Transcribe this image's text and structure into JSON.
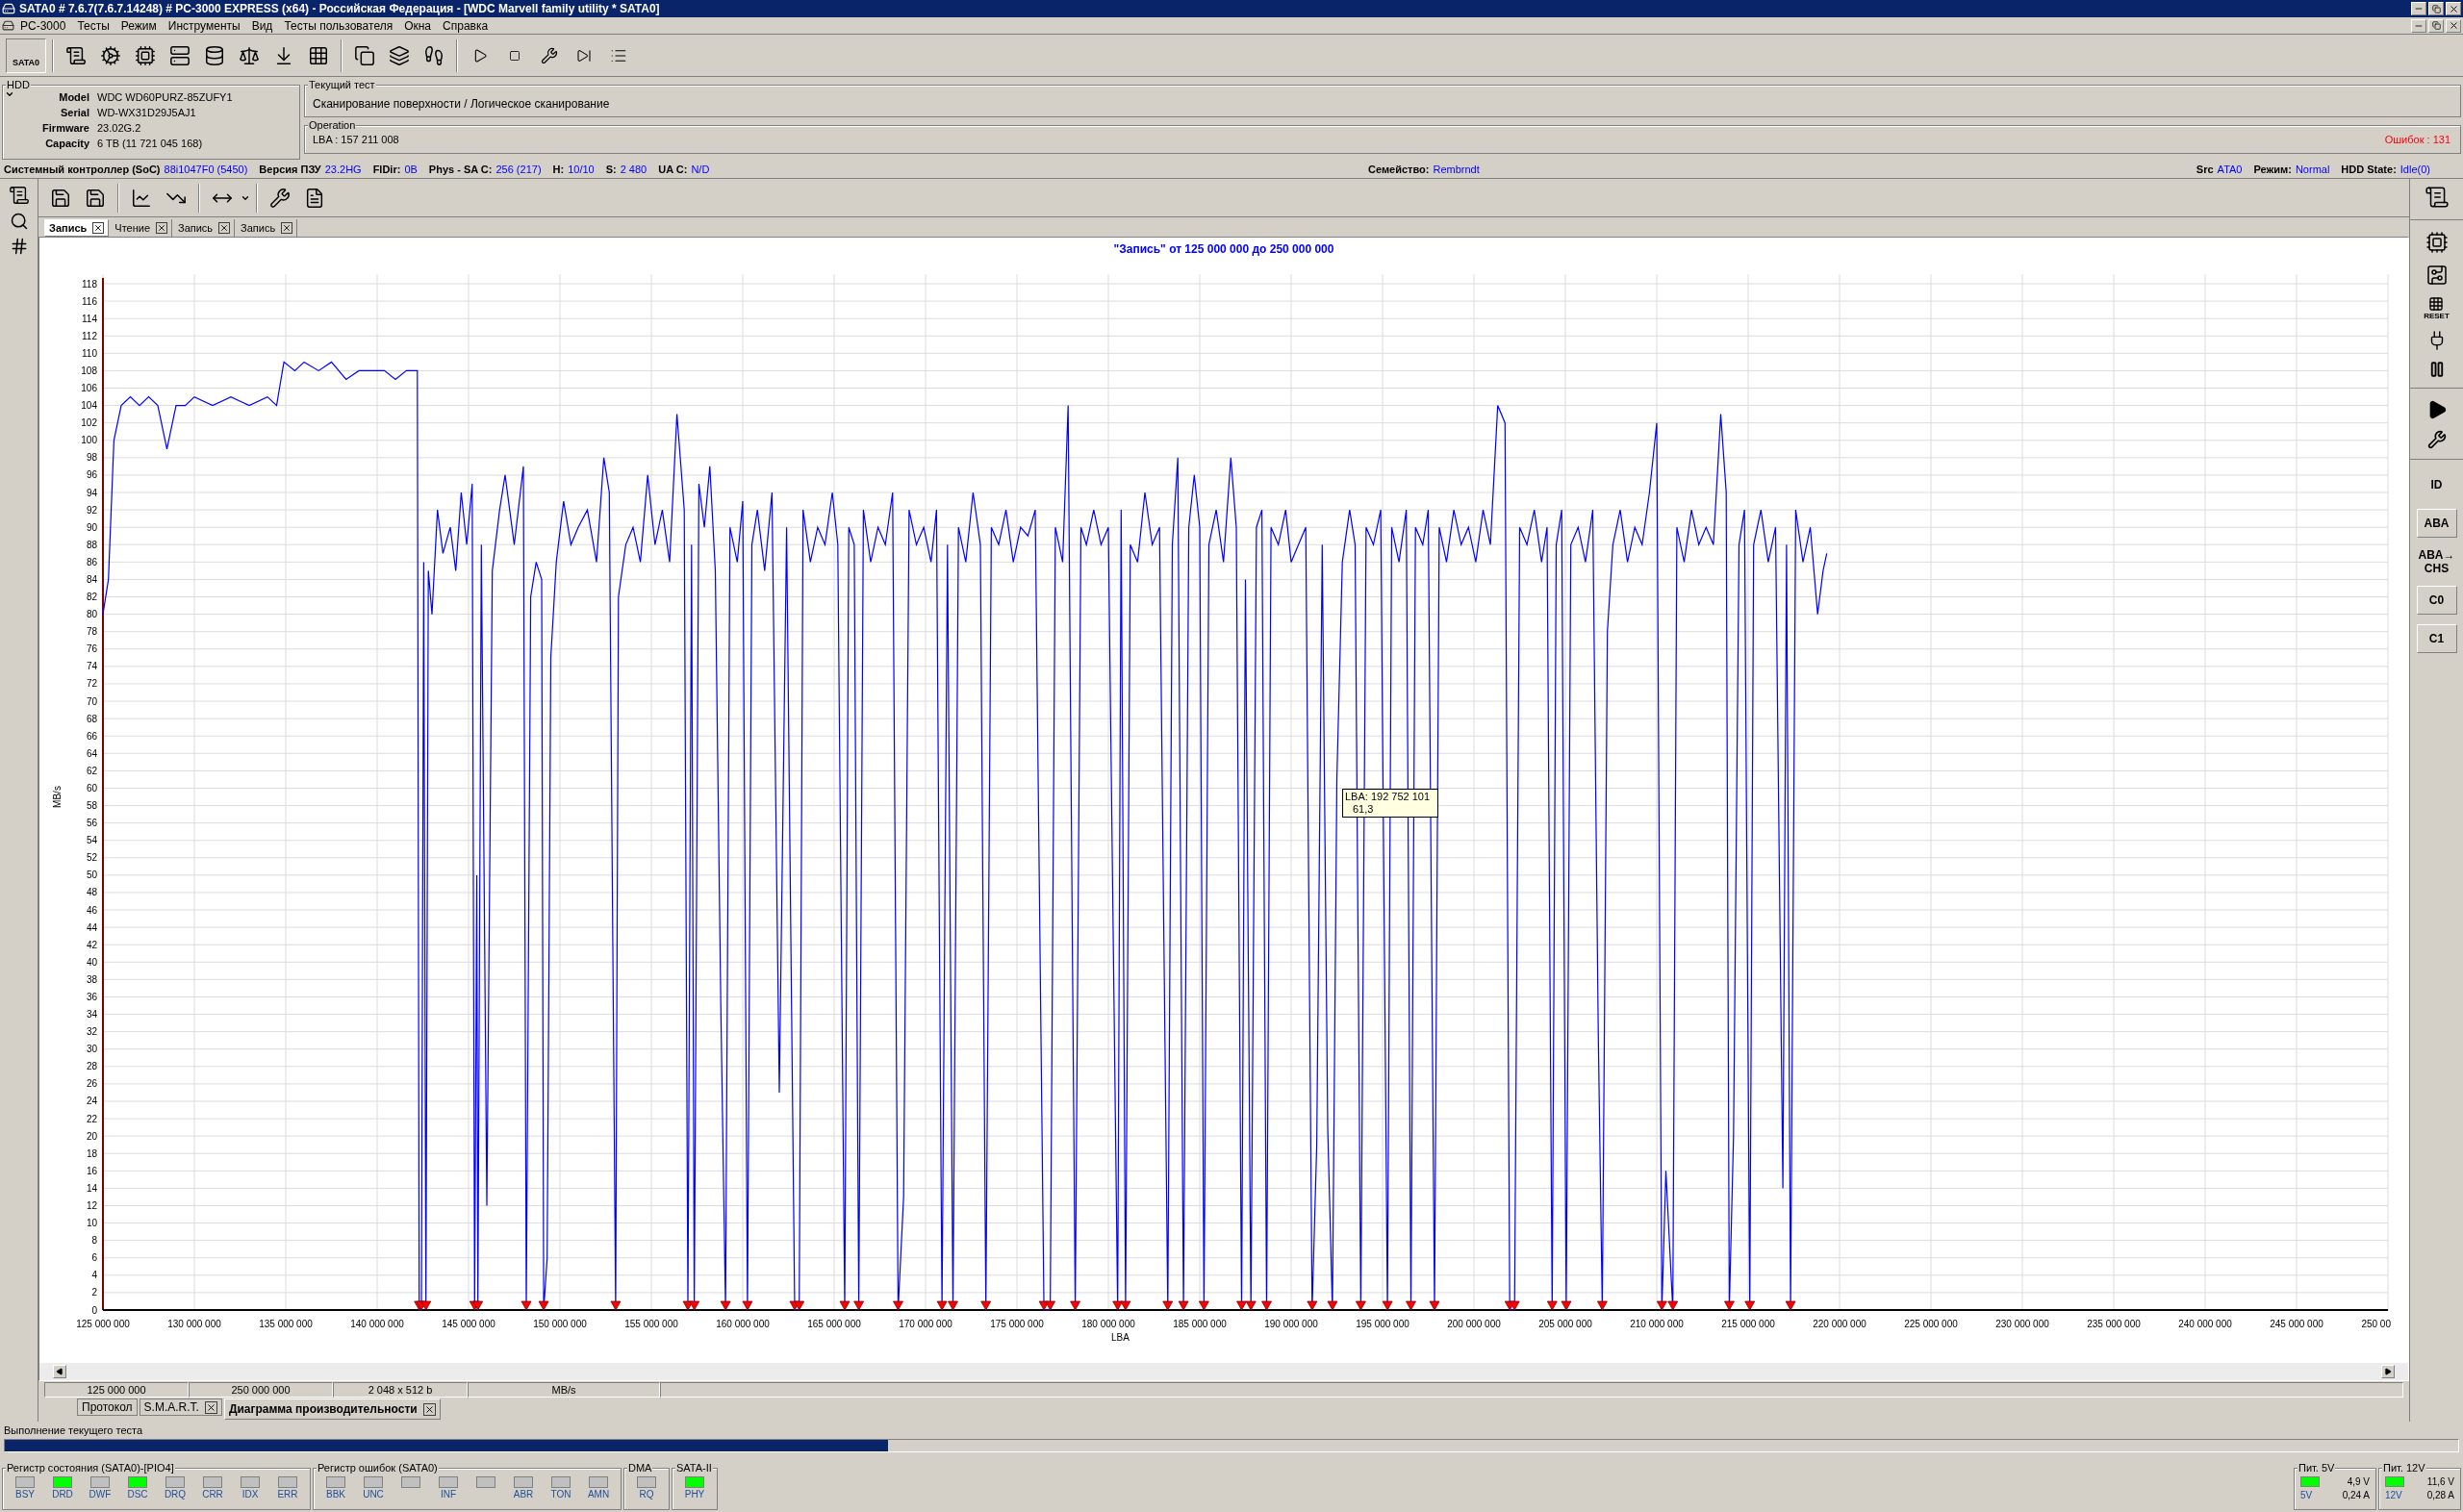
{
  "window": {
    "title": "SATA0 # 7.6.7(7.6.7.14248) # PC-3000 EXPRESS (x64) - Российская Федерация - [WDC Marvell family utility * SATA0]"
  },
  "menu": [
    "PC-3000",
    "Тесты",
    "Режим",
    "Инструменты",
    "Вид",
    "Тесты пользователя",
    "Окна",
    "Справка"
  ],
  "toolbar": {
    "port": "SATA0"
  },
  "hdd": {
    "title": "HDD",
    "fields": [
      {
        "label": "Model",
        "value": "WDC WD60PURZ-85ZUFY1"
      },
      {
        "label": "Serial",
        "value": "WD-WX31D29J5AJ1"
      },
      {
        "label": "Firmware",
        "value": "23.02G.2"
      },
      {
        "label": "Capacity",
        "value": "6 TB (11 721 045 168)"
      }
    ]
  },
  "current_test": {
    "title": "Текущий тест",
    "text": "Сканирование поверхности / Логическое сканирование"
  },
  "operation": {
    "title": "Operation",
    "text": "LBA : 157 211 008",
    "errors": "Ошибок : 131"
  },
  "info_line": {
    "left": [
      {
        "label": "Системный контроллер (SoC)",
        "value": "88i1047F0 (5450)"
      },
      {
        "label": "Версия ПЗУ",
        "value": "23.2HG"
      },
      {
        "label": "FlDir:",
        "value": "0B"
      },
      {
        "label": "Phys - SA C:",
        "value": "256 (217)"
      },
      {
        "label": "H:",
        "value": "10/10"
      },
      {
        "label": "S:",
        "value": "2 480"
      },
      {
        "label": "UA C:",
        "value": "N/D"
      }
    ],
    "middle": [
      {
        "label": "Семейство:",
        "value": "Rembrndt"
      }
    ],
    "right": [
      {
        "label": "Src",
        "value": "ATA0"
      },
      {
        "label": "Режим:",
        "value": "Normal"
      },
      {
        "label": "HDD State:",
        "value": "Idle(0)"
      }
    ]
  },
  "right_toolbar": {
    "reset_label": "RESET",
    "buttons": [
      "ID",
      "ABA",
      "ABA→CHS",
      "C0",
      "C1"
    ]
  },
  "chart_tabs": [
    {
      "label": "Запись",
      "selected": true
    },
    {
      "label": "Чтение",
      "selected": false
    },
    {
      "label": "Запись",
      "selected": false
    },
    {
      "label": "Запись",
      "selected": false
    }
  ],
  "chart": {
    "tooltip": {
      "lba": "LBA: 192 752 101",
      "value": "61,3"
    },
    "chart_data": {
      "type": "line",
      "title": "\"Запись\" от 125 000 000 до 250 000 000",
      "xlabel": "LBA",
      "ylabel": "MB/s",
      "xlim": [
        125000000,
        250000000
      ],
      "ylim": [
        0,
        118
      ],
      "yticks": [
        0,
        2,
        4,
        6,
        8,
        10,
        12,
        14,
        16,
        18,
        20,
        22,
        24,
        26,
        28,
        30,
        32,
        34,
        36,
        38,
        40,
        42,
        44,
        46,
        48,
        50,
        52,
        54,
        56,
        58,
        60,
        62,
        64,
        66,
        68,
        70,
        72,
        74,
        76,
        78,
        80,
        82,
        84,
        86,
        88,
        90,
        92,
        94,
        96,
        98,
        100,
        102,
        104,
        106,
        108,
        110,
        112,
        114,
        116,
        118
      ],
      "xticks": [
        {
          "value": 125000000,
          "label": "125 000 000"
        },
        {
          "value": 130000000,
          "label": "130 000 000"
        },
        {
          "value": 135000000,
          "label": "135 000 000"
        },
        {
          "value": 140000000,
          "label": "140 000 000"
        },
        {
          "value": 145000000,
          "label": "145 000 000"
        },
        {
          "value": 150000000,
          "label": "150 000 000"
        },
        {
          "value": 155000000,
          "label": "155 000 000"
        },
        {
          "value": 160000000,
          "label": "160 000 000"
        },
        {
          "value": 165000000,
          "label": "165 000 000"
        },
        {
          "value": 170000000,
          "label": "170 000 000"
        },
        {
          "value": 175000000,
          "label": "175 000 000"
        },
        {
          "value": 180000000,
          "label": "180 000 000"
        },
        {
          "value": 185000000,
          "label": "185 000 000"
        },
        {
          "value": 190000000,
          "label": "190 000 000"
        },
        {
          "value": 195000000,
          "label": "195 000 000"
        },
        {
          "value": 200000000,
          "label": "200 000 000"
        },
        {
          "value": 205000000,
          "label": "205 000 000"
        },
        {
          "value": 210000000,
          "label": "210 000 000"
        },
        {
          "value": 215000000,
          "label": "215 000 000"
        },
        {
          "value": 220000000,
          "label": "220 000 000"
        },
        {
          "value": 225000000,
          "label": "225 000 000"
        },
        {
          "value": 230000000,
          "label": "230 000 000"
        },
        {
          "value": 235000000,
          "label": "235 000 000"
        },
        {
          "value": 240000000,
          "label": "240 000 000"
        },
        {
          "value": 245000000,
          "label": "245 000 000"
        },
        {
          "value": 250000000,
          "label": "250 00"
        }
      ],
      "x": [
        125000000,
        125300000,
        125600000,
        126000000,
        126500000,
        127000000,
        127500000,
        128000000,
        128500000,
        129000000,
        129500000,
        130000000,
        131000000,
        132000000,
        133000000,
        134000000,
        134500000,
        134900000,
        135500000,
        136000000,
        136800000,
        137500000,
        138300000,
        139000000,
        139700000,
        140400000,
        141000000,
        141600000,
        142200000,
        142300000,
        142420000,
        142550000,
        142670000,
        142800000,
        143000000,
        143300000,
        143600000,
        144000000,
        144300000,
        144600000,
        144900000,
        145200000,
        145330000,
        145450000,
        145510000,
        145700000,
        146000000,
        146300000,
        146700000,
        147000000,
        147500000,
        148000000,
        148160000,
        148400000,
        148700000,
        149000000,
        149110000,
        149300000,
        149500000,
        149800000,
        150200000,
        150600000,
        151000000,
        151500000,
        152000000,
        152400000,
        152700000,
        153050000,
        153200000,
        153600000,
        154000000,
        154400000,
        154800000,
        155200000,
        155600000,
        156000000,
        156400000,
        156800000,
        157000000,
        157200000,
        157350000,
        157600000,
        157900000,
        158200000,
        158500000,
        158800000,
        159060000,
        159300000,
        159700000,
        160000000,
        160260000,
        160500000,
        160800000,
        161200000,
        161600000,
        162000000,
        162400000,
        162840000,
        163090000,
        163300000,
        163700000,
        164100000,
        164500000,
        164900000,
        165200000,
        165580000,
        165800000,
        166100000,
        166350000,
        166600000,
        167000000,
        167400000,
        167800000,
        168200000,
        168500000,
        168800000,
        169100000,
        169500000,
        169900000,
        170300000,
        170600000,
        170900000,
        171200000,
        171500000,
        171800000,
        172200000,
        172600000,
        173000000,
        173300000,
        173600000,
        174000000,
        174400000,
        174800000,
        175200000,
        175600000,
        176000000,
        176480000,
        176820000,
        177100000,
        177500000,
        177800000,
        178190000,
        178500000,
        178800000,
        179200000,
        179600000,
        180000000,
        180510000,
        180700000,
        180940000,
        181200000,
        181600000,
        182000000,
        182400000,
        182800000,
        183250000,
        183500000,
        183800000,
        184110000,
        184400000,
        184700000,
        185000000,
        185230000,
        185500000,
        185900000,
        186300000,
        186700000,
        187000000,
        187290000,
        187500000,
        187800000,
        188100000,
        188400000,
        188660000,
        188900000,
        189300000,
        189700000,
        190000000,
        190400000,
        190800000,
        191150000,
        191400000,
        191700000,
        192000000,
        192260000,
        192500000,
        192800000,
        193200000,
        193500000,
        193810000,
        194100000,
        194500000,
        194900000,
        195270000,
        195500000,
        195900000,
        196300000,
        196550000,
        196800000,
        197200000,
        197500000,
        197840000,
        198100000,
        198500000,
        198900000,
        199300000,
        199700000,
        200100000,
        200500000,
        200900000,
        201300000,
        201700000,
        201960000,
        202220000,
        202500000,
        202900000,
        203300000,
        203700000,
        204000000,
        204280000,
        204500000,
        204800000,
        205050000,
        205300000,
        205700000,
        206100000,
        206500000,
        206800000,
        207020000,
        207300000,
        207600000,
        208000000,
        208400000,
        208800000,
        209200000,
        209600000,
        210000000,
        210280000,
        210500000,
        210880000,
        211100000,
        211500000,
        211900000,
        212300000,
        212700000,
        213100000,
        213500000,
        213800000,
        213970000,
        214200000,
        214500000,
        214800000,
        215090000,
        215300000,
        215700000,
        216100000,
        216500000,
        216900000,
        217100000,
        217320000,
        217600000,
        218000000,
        218400000,
        218800000,
        219100000,
        219300000
      ],
      "values": [
        80,
        84,
        100,
        104,
        105,
        104,
        105,
        104,
        99,
        104,
        104,
        105,
        104,
        105,
        104,
        105,
        104,
        109,
        108,
        109,
        108,
        109,
        107,
        108,
        108,
        108,
        107,
        108,
        108,
        0,
        0,
        86,
        0,
        85,
        80,
        92,
        87,
        90,
        85,
        94,
        88,
        95,
        0,
        50,
        0,
        88,
        12,
        85,
        92,
        96,
        88,
        97,
        0,
        82,
        86,
        84,
        0,
        6,
        75,
        86,
        93,
        88,
        90,
        92,
        86,
        98,
        94,
        0,
        82,
        88,
        90,
        86,
        96,
        88,
        92,
        86,
        103,
        92,
        0,
        88,
        0,
        95,
        90,
        97,
        85,
        35,
        0,
        90,
        86,
        93,
        0,
        88,
        92,
        85,
        94,
        25,
        90,
        0,
        0,
        92,
        86,
        90,
        88,
        94,
        88,
        0,
        90,
        88,
        0,
        92,
        86,
        90,
        88,
        94,
        0,
        13,
        92,
        88,
        90,
        86,
        92,
        0,
        88,
        0,
        90,
        86,
        94,
        88,
        0,
        90,
        88,
        92,
        86,
        90,
        89,
        92,
        0,
        0,
        90,
        86,
        104,
        0,
        90,
        88,
        92,
        88,
        90,
        0,
        92,
        0,
        88,
        86,
        94,
        88,
        90,
        0,
        88,
        98,
        0,
        90,
        96,
        90,
        0,
        88,
        92,
        86,
        98,
        90,
        0,
        84,
        0,
        90,
        92,
        0,
        90,
        88,
        92,
        86,
        88,
        90,
        0,
        19,
        88,
        21,
        0,
        61,
        86,
        92,
        88,
        0,
        90,
        88,
        92,
        0,
        90,
        86,
        92,
        0,
        90,
        88,
        92,
        0,
        90,
        86,
        92,
        88,
        90,
        86,
        92,
        88,
        104,
        102,
        0,
        0,
        90,
        88,
        92,
        86,
        90,
        0,
        88,
        92,
        0,
        88,
        90,
        86,
        92,
        32,
        0,
        78,
        88,
        92,
        86,
        90,
        88,
        94,
        102,
        0,
        16,
        0,
        90,
        86,
        92,
        88,
        90,
        88,
        103,
        94,
        0,
        20,
        88,
        92,
        0,
        88,
        92,
        86,
        90,
        14,
        88,
        0,
        92,
        86,
        90,
        80,
        85,
        87
      ],
      "grid": true
    }
  },
  "chart_status": [
    "125 000 000",
    "250 000 000",
    "2 048 x 512 b",
    "MB/s"
  ],
  "bottom_tabs": [
    {
      "label": "Протокол",
      "selected": false,
      "closable": false
    },
    {
      "label": "S.M.A.R.T.",
      "selected": false,
      "closable": true
    },
    {
      "label": "Диаграмма производительности",
      "selected": true,
      "closable": true
    }
  ],
  "progress": {
    "label": "Выполнение текущего теста",
    "level": 0.36
  },
  "registers": [
    {
      "title": "Регистр состояния (SATA0)-[PIO4]",
      "bits": [
        {
          "label": "BSY",
          "on": false
        },
        {
          "label": "DRD",
          "on": true
        },
        {
          "label": "DWF",
          "on": false
        },
        {
          "label": "DSC",
          "on": true
        },
        {
          "label": "DRQ",
          "on": false
        },
        {
          "label": "CRR",
          "on": false
        },
        {
          "label": "IDX",
          "on": false
        },
        {
          "label": "ERR",
          "on": false
        }
      ]
    },
    {
      "title": "Регистр ошибок  (SATA0)",
      "bits": [
        {
          "label": "BBK",
          "on": false
        },
        {
          "label": "UNC",
          "on": false
        },
        {
          "on": false
        },
        {
          "label": "INF",
          "on": false
        },
        {
          "on": false
        },
        {
          "label": "ABR",
          "on": false
        },
        {
          "label": "TON",
          "on": false
        },
        {
          "label": "AMN",
          "on": false
        }
      ]
    },
    {
      "title": "DMA",
      "bits": [
        {
          "label": "RQ",
          "on": false
        }
      ]
    },
    {
      "title": "SATA-II",
      "bits": [
        {
          "label": "PHY",
          "on": true
        }
      ]
    }
  ],
  "power": [
    {
      "title": "Пит. 5V",
      "on": true,
      "label": "5V",
      "voltage": "4,9 V",
      "current": "0,24 A"
    },
    {
      "title": "Пит. 12V",
      "on": true,
      "label": "12V",
      "voltage": "11,6 V",
      "current": "0,28 A"
    }
  ]
}
